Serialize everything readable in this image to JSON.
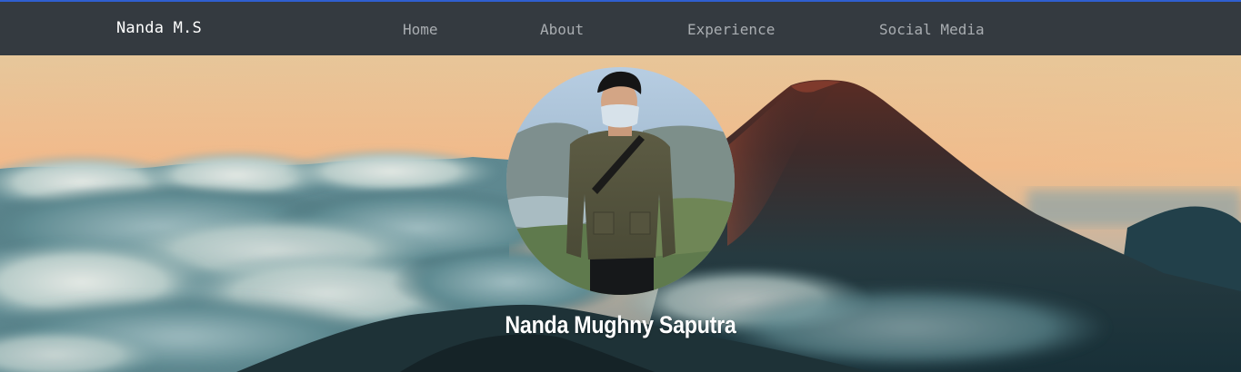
{
  "navbar": {
    "brand": "Nanda M.S",
    "links": [
      {
        "label": "Home"
      },
      {
        "label": "About"
      },
      {
        "label": "Experience"
      },
      {
        "label": "Social Media"
      }
    ],
    "background_color": "#343a40",
    "accent_top_border": "#2f5fd0"
  },
  "hero": {
    "name": "Nanda Mughny Saputra",
    "background_image": "mountain-above-clouds-at-sunset",
    "profile_image": "man-wearing-mask-and-jacket"
  }
}
